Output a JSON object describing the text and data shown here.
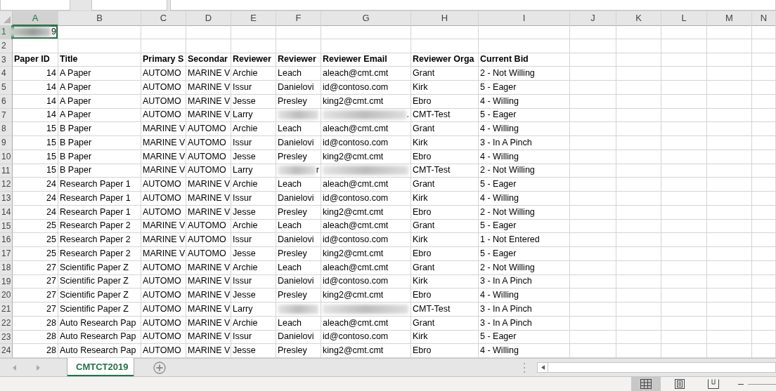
{
  "columns": [
    {
      "label": "A",
      "selected": true
    },
    {
      "label": "B",
      "selected": false
    },
    {
      "label": "C",
      "selected": false
    },
    {
      "label": "D",
      "selected": false
    },
    {
      "label": "E",
      "selected": false
    },
    {
      "label": "F",
      "selected": false
    },
    {
      "label": "G",
      "selected": false
    },
    {
      "label": "H",
      "selected": false
    },
    {
      "label": "I",
      "selected": false
    },
    {
      "label": "J",
      "selected": false
    },
    {
      "label": "K",
      "selected": false
    },
    {
      "label": "L",
      "selected": false
    },
    {
      "label": "M",
      "selected": false
    },
    {
      "label": "N",
      "selected": false
    }
  ],
  "rows": [
    {
      "number": "1",
      "selected": true,
      "cells": [
        {
          "redacted": true,
          "text": "9"
        }
      ]
    },
    {
      "number": "2",
      "selected": false,
      "cells": []
    },
    {
      "number": "3",
      "selected": false,
      "kind": "header",
      "cells": [
        "Paper ID",
        "Title",
        "Primary S",
        "Secondar",
        "Reviewer",
        "Reviewer",
        "Reviewer Email",
        "Reviewer Orga",
        "Current Bid"
      ]
    },
    {
      "number": "4",
      "selected": false,
      "cells": [
        "14",
        "A Paper",
        "AUTOMO",
        "MARINE V",
        "Archie",
        "Leach",
        "aleach@cmt.cmt",
        "Grant",
        "2 - Not Willing"
      ]
    },
    {
      "number": "5",
      "selected": false,
      "cells": [
        "14",
        "A Paper",
        "AUTOMO",
        "MARINE V",
        "Issur",
        "Danielovi",
        "id@contoso.com",
        "Kirk",
        "5 - Eager"
      ]
    },
    {
      "number": "6",
      "selected": false,
      "cells": [
        "14",
        "A Paper",
        "AUTOMO",
        "MARINE V",
        "Jesse",
        "Presley",
        "king2@cmt.cmt",
        "Ebro",
        "4 - Willing"
      ]
    },
    {
      "number": "7",
      "selected": false,
      "cells": [
        "14",
        "A Paper",
        "AUTOMO",
        "MARINE V",
        "Larry",
        {
          "redacted": true
        },
        {
          "redacted": true,
          "text": "."
        },
        "CMT-Test",
        "5 - Eager"
      ]
    },
    {
      "number": "8",
      "selected": false,
      "cells": [
        "15",
        "B Paper",
        "MARINE V",
        "AUTOMO",
        "Archie",
        "Leach",
        "aleach@cmt.cmt",
        "Grant",
        "4 - Willing"
      ]
    },
    {
      "number": "9",
      "selected": false,
      "cells": [
        "15",
        "B Paper",
        "MARINE V",
        "AUTOMO",
        "Issur",
        "Danielovi",
        "id@contoso.com",
        "Kirk",
        "3 - In A Pinch"
      ]
    },
    {
      "number": "10",
      "selected": false,
      "cells": [
        "15",
        "B Paper",
        "MARINE V",
        "AUTOMO",
        "Jesse",
        "Presley",
        "king2@cmt.cmt",
        "Ebro",
        "4 - Willing"
      ]
    },
    {
      "number": "11",
      "selected": false,
      "cells": [
        "15",
        "B Paper",
        "MARINE V",
        "AUTOMO",
        "Larry",
        {
          "redacted": true,
          "text": "r"
        },
        {
          "redacted": true
        },
        "CMT-Test",
        "2 - Not Willing"
      ]
    },
    {
      "number": "12",
      "selected": false,
      "cells": [
        "24",
        "Research Paper 1",
        "AUTOMO",
        "MARINE V",
        "Archie",
        "Leach",
        "aleach@cmt.cmt",
        "Grant",
        "5 - Eager"
      ]
    },
    {
      "number": "13",
      "selected": false,
      "cells": [
        "24",
        "Research Paper 1",
        "AUTOMO",
        "MARINE V",
        "Issur",
        "Danielovi",
        "id@contoso.com",
        "Kirk",
        "4 - Willing"
      ]
    },
    {
      "number": "14",
      "selected": false,
      "cells": [
        "24",
        "Research Paper 1",
        "AUTOMO",
        "MARINE V",
        "Jesse",
        "Presley",
        "king2@cmt.cmt",
        "Ebro",
        "2 - Not Willing"
      ]
    },
    {
      "number": "15",
      "selected": false,
      "cells": [
        "25",
        "Research Paper 2",
        "MARINE V",
        "AUTOMO",
        "Archie",
        "Leach",
        "aleach@cmt.cmt",
        "Grant",
        "5 - Eager"
      ]
    },
    {
      "number": "16",
      "selected": false,
      "cells": [
        "25",
        "Research Paper 2",
        "MARINE V",
        "AUTOMO",
        "Issur",
        "Danielovi",
        "id@contoso.com",
        "Kirk",
        "1 - Not Entered"
      ]
    },
    {
      "number": "17",
      "selected": false,
      "cells": [
        "25",
        "Research Paper 2",
        "MARINE V",
        "AUTOMO",
        "Jesse",
        "Presley",
        "king2@cmt.cmt",
        "Ebro",
        "5 - Eager"
      ]
    },
    {
      "number": "18",
      "selected": false,
      "cells": [
        "27",
        "Scientific Paper Z",
        "AUTOMO",
        "MARINE V",
        "Archie",
        "Leach",
        "aleach@cmt.cmt",
        "Grant",
        "2 - Not Willing"
      ]
    },
    {
      "number": "19",
      "selected": false,
      "cells": [
        "27",
        "Scientific Paper Z",
        "AUTOMO",
        "MARINE V",
        "Issur",
        "Danielovi",
        "id@contoso.com",
        "Kirk",
        "3 - In A Pinch"
      ]
    },
    {
      "number": "20",
      "selected": false,
      "cells": [
        "27",
        "Scientific Paper Z",
        "AUTOMO",
        "MARINE V",
        "Jesse",
        "Presley",
        "king2@cmt.cmt",
        "Ebro",
        "4 - Willing"
      ]
    },
    {
      "number": "21",
      "selected": false,
      "cells": [
        "27",
        "Scientific Paper Z",
        "AUTOMO",
        "MARINE V",
        "Larry",
        {
          "redacted": true
        },
        {
          "redacted": true
        },
        "CMT-Test",
        "3 - In A Pinch"
      ]
    },
    {
      "number": "22",
      "selected": false,
      "cells": [
        "28",
        "Auto Research Pap",
        "AUTOMO",
        "MARINE V",
        "Archie",
        "Leach",
        "aleach@cmt.cmt",
        "Grant",
        "3 - In A Pinch"
      ]
    },
    {
      "number": "23",
      "selected": false,
      "cells": [
        "28",
        "Auto Research Pap",
        "AUTOMO",
        "MARINE V",
        "Issur",
        "Danielovi",
        "id@contoso.com",
        "Kirk",
        "5 - Eager"
      ]
    },
    {
      "number": "24",
      "selected": false,
      "cells": [
        "28",
        "Auto Research Pap",
        "AUTOMO",
        "MARINE V",
        "Jesse",
        "Presley",
        "king2@cmt.cmt",
        "Ebro",
        "4 - Willing"
      ]
    }
  ],
  "sheet_tabs": [
    {
      "label": "CMTCT2019",
      "selected": true
    }
  ],
  "views": [
    {
      "kind": "normal",
      "selected": true
    },
    {
      "kind": "page-layout",
      "selected": false
    },
    {
      "kind": "page-break",
      "selected": false
    }
  ]
}
